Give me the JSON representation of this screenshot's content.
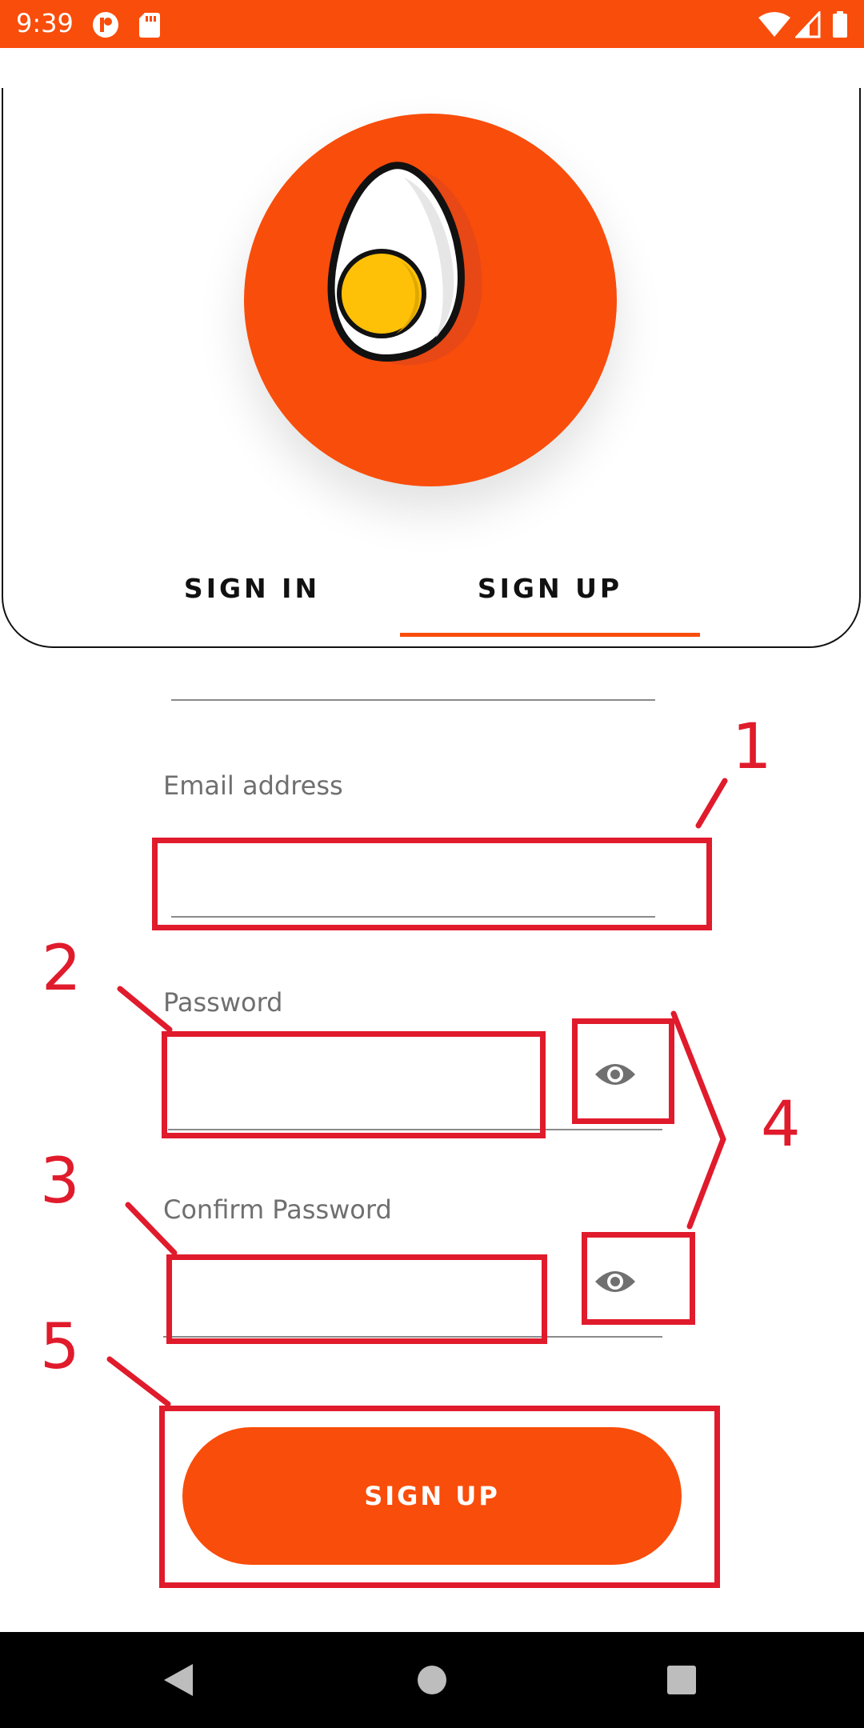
{
  "status_bar": {
    "time": "9:39",
    "icons": [
      "notification-app-icon",
      "sd-card-icon",
      "wifi-icon",
      "signal-icon",
      "battery-icon"
    ]
  },
  "tabs": [
    {
      "label": "SIGN IN",
      "selected": false
    },
    {
      "label": "SIGN UP",
      "selected": true
    }
  ],
  "form": {
    "email_label": "Email address",
    "password_label": "Password",
    "confirm_password_label": "Confirm Password",
    "email_value": "",
    "password_value": "",
    "confirm_password_value": ""
  },
  "button": {
    "label": "SIGN UP"
  },
  "annotations": {
    "n1": "1",
    "n2": "2",
    "n3": "3",
    "n4": "4",
    "n5": "5"
  },
  "colors": {
    "accent": "#F94D0B",
    "annotation": "#E01B2C"
  },
  "nav_icons": [
    "back-icon",
    "home-icon",
    "recents-icon"
  ]
}
